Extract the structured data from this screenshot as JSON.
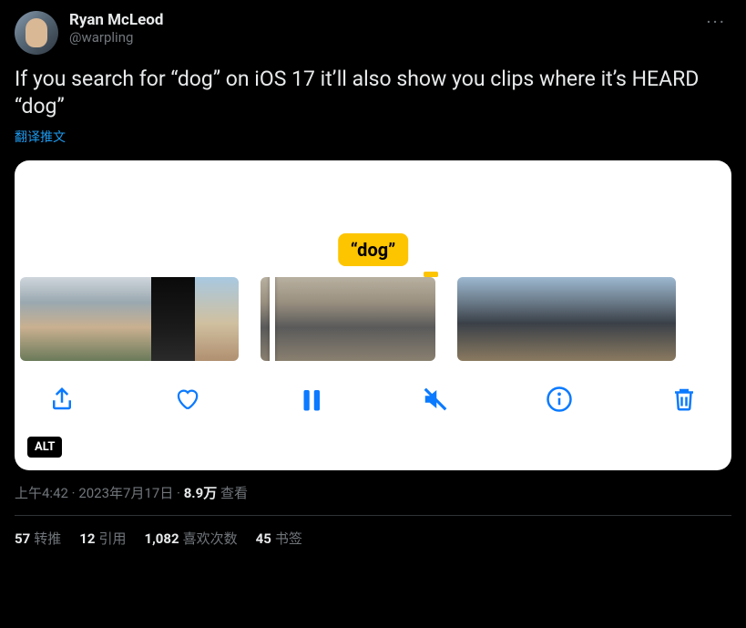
{
  "user": {
    "display_name": "Ryan McLeod",
    "handle": "@warpling"
  },
  "tweet": {
    "text": "If you search for “dog” on iOS 17 it’ll also show you clips where it’s HEARD “dog”",
    "translate": "翻译推文"
  },
  "media": {
    "badge": "“dog”",
    "alt": "ALT"
  },
  "meta": {
    "time": "上午4:42",
    "date": "2023年7月17日",
    "views_count": "8.9万",
    "views_label": "查看"
  },
  "stats": {
    "retweets_count": "57",
    "retweets_label": "转推",
    "quotes_count": "12",
    "quotes_label": "引用",
    "likes_count": "1,082",
    "likes_label": "喜欢次数",
    "bookmarks_count": "45",
    "bookmarks_label": "书签"
  }
}
